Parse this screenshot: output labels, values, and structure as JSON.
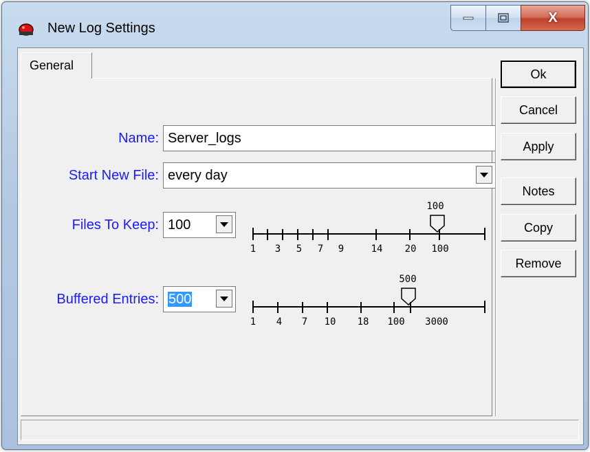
{
  "window": {
    "title": "New Log Settings",
    "icon": "red-bug-icon",
    "controls": [
      "minimize-icon",
      "maximize-icon",
      "close-icon"
    ],
    "close_label": "X"
  },
  "tabs": [
    {
      "label": "General",
      "selected": true
    }
  ],
  "form": {
    "name": {
      "label": "Name:",
      "value": "Server_logs"
    },
    "start_new_file": {
      "label": "Start New File:",
      "value": "every day"
    },
    "files_to_keep": {
      "label": "Files To Keep:",
      "value": "100",
      "slider_value_label": "100",
      "slider_ticks": [
        "1",
        "3",
        "5",
        "7",
        "9",
        "14",
        "20",
        "100"
      ]
    },
    "buffered_entries": {
      "label": "Buffered Entries:",
      "value": "500",
      "value_selected": true,
      "slider_value_label": "500",
      "slider_ticks": [
        "1",
        "4",
        "7",
        "10",
        "18",
        "100",
        "3000"
      ]
    }
  },
  "buttons": {
    "ok": "Ok",
    "cancel": "Cancel",
    "apply": "Apply",
    "notes": "Notes",
    "copy": "Copy",
    "remove": "Remove"
  },
  "colors": {
    "label_text": "#1a1aff",
    "selection": "#3399ff",
    "close_button": "#c0412b"
  }
}
